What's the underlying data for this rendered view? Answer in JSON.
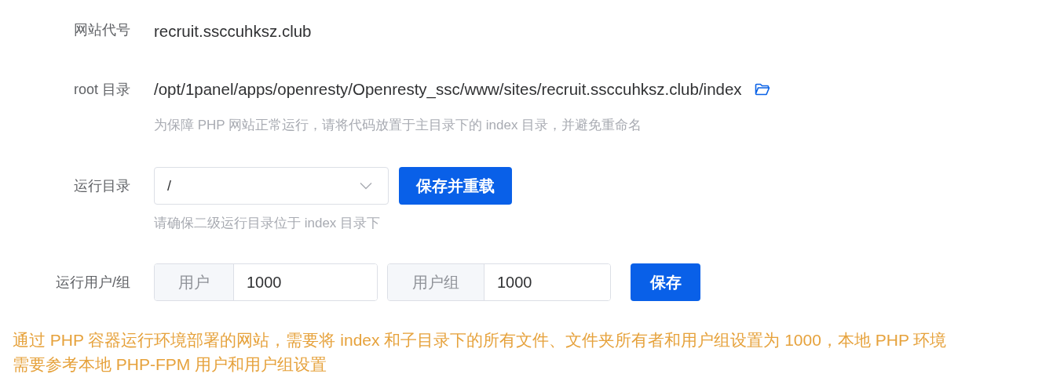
{
  "site_code": {
    "label": "网站代号",
    "value": "recruit.ssccuhksz.club"
  },
  "root_dir": {
    "label": "root 目录",
    "value": "/opt/1panel/apps/openresty/Openresty_ssc/www/sites/recruit.ssccuhksz.club/index",
    "hint": "为保障 PHP 网站正常运行，请将代码放置于主目录下的 index 目录，并避免重命名"
  },
  "run_dir": {
    "label": "运行目录",
    "value": "/",
    "button": "保存并重载",
    "hint": "请确保二级运行目录位于 index 目录下"
  },
  "run_user": {
    "label": "运行用户/组",
    "fields": [
      {
        "prepend": "用户",
        "value": "1000"
      },
      {
        "prepend": "用户组",
        "value": "1000"
      }
    ],
    "button": "保存"
  },
  "warning": "通过 PHP 容器运行环境部署的网站，需要将 index 和子目录下的所有文件、文件夹所有者和用户组设置为 1000，本地 PHP 环境需要参考本地 PHP-FPM 用户和用户组设置"
}
